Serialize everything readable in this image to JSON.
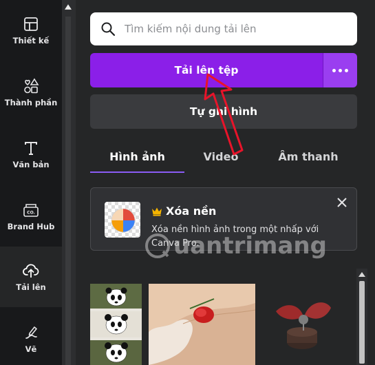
{
  "sidebar": {
    "items": [
      {
        "label": "Thiết kế",
        "icon": "layout-icon"
      },
      {
        "label": "Thành phần",
        "icon": "shapes-icon"
      },
      {
        "label": "Văn bản",
        "icon": "text-icon"
      },
      {
        "label": "Brand Hub",
        "icon": "brand-hub-icon"
      },
      {
        "label": "Tải lên",
        "icon": "cloud-upload-icon",
        "active": true
      },
      {
        "label": "Vẽ",
        "icon": "draw-icon"
      }
    ]
  },
  "search": {
    "placeholder": "Tìm kiếm nội dung tải lên",
    "icon": "search-icon"
  },
  "upload": {
    "label": "Tải lên tệp",
    "more_icon": "more-dots-icon"
  },
  "record": {
    "label": "Tự ghi hình"
  },
  "tabs": [
    {
      "label": "Hình ảnh",
      "active": true
    },
    {
      "label": "Video"
    },
    {
      "label": "Âm thanh"
    }
  ],
  "promo": {
    "title": "Xóa nền",
    "description": "Xóa nền hình ảnh trong một nhấp với Canva Pro.",
    "crown_icon": "crown-icon",
    "close_icon": "close-icon"
  },
  "watermark": {
    "text": "uantrimang"
  },
  "colors": {
    "accent": "#8b1fe8",
    "panel": "#252627",
    "sidebar": "#18191b",
    "annotation_arrow": "#e8142a"
  }
}
